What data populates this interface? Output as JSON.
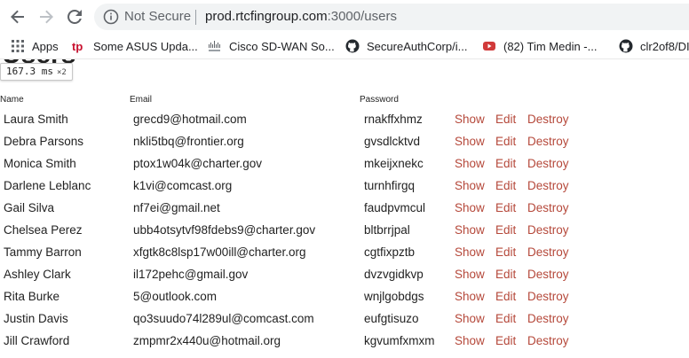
{
  "browser": {
    "security_label": "Not Secure",
    "url_host": "prod.rtcfingroup.com",
    "url_rest": ":3000/users"
  },
  "bookmarks": [
    {
      "icon": "apps-grid-icon",
      "label": "Apps"
    },
    {
      "icon": "tp-logo-icon",
      "label": "Some ASUS Upda..."
    },
    {
      "icon": "cisco-icon",
      "label": "Cisco SD-WAN So..."
    },
    {
      "icon": "github-icon",
      "label": "SecureAuthCorp/i..."
    },
    {
      "icon": "youtube-icon",
      "label": "(82) Tim Medin -..."
    },
    {
      "icon": "github-icon",
      "label": "clr2of8/DI"
    }
  ],
  "page": {
    "title": "Users",
    "perf_badge": "167.3 ms",
    "perf_multiplier": "×2",
    "columns": [
      "Name",
      "Email",
      "Password"
    ],
    "action_labels": {
      "show": "Show",
      "edit": "Edit",
      "destroy": "Destroy"
    },
    "users": [
      {
        "name": "Laura Smith",
        "email": "grecd9@hotmail.com",
        "password": "rnakffxhmz"
      },
      {
        "name": "Debra Parsons",
        "email": "nkli5tbq@frontier.org",
        "password": "gvsdlcktvd"
      },
      {
        "name": "Monica Smith",
        "email": "ptox1w04k@charter.gov",
        "password": "mkeijxnekc"
      },
      {
        "name": "Darlene Leblanc",
        "email": "k1vi@comcast.org",
        "password": "turnhfirgq"
      },
      {
        "name": "Gail Silva",
        "email": "nf7ei@gmail.net",
        "password": "faudpvmcul"
      },
      {
        "name": "Chelsea Perez",
        "email": "ubb4otsytvf98fdebs9@charter.gov",
        "password": "bltbrrjpal"
      },
      {
        "name": "Tammy Barron",
        "email": "xfgtk8c8lsp17w00ill@charter.org",
        "password": "cgtfixpztb"
      },
      {
        "name": "Ashley Clark",
        "email": "il172pehc@gmail.gov",
        "password": "dvzvgidkvp"
      },
      {
        "name": "Rita Burke",
        "email": "5@outlook.com",
        "password": "wnjlgobdgs"
      },
      {
        "name": "Justin Davis",
        "email": "qo3suudo74l289ul@comcast.com",
        "password": "eufgtisuzo"
      },
      {
        "name": "Jill Crawford",
        "email": "zmpmr2x440u@hotmail.org",
        "password": "kgvumfxmxm"
      }
    ]
  },
  "colors": {
    "link": "#b5483a",
    "omnibox_bg": "#f1f3f4",
    "muted_text": "#5f6368"
  }
}
